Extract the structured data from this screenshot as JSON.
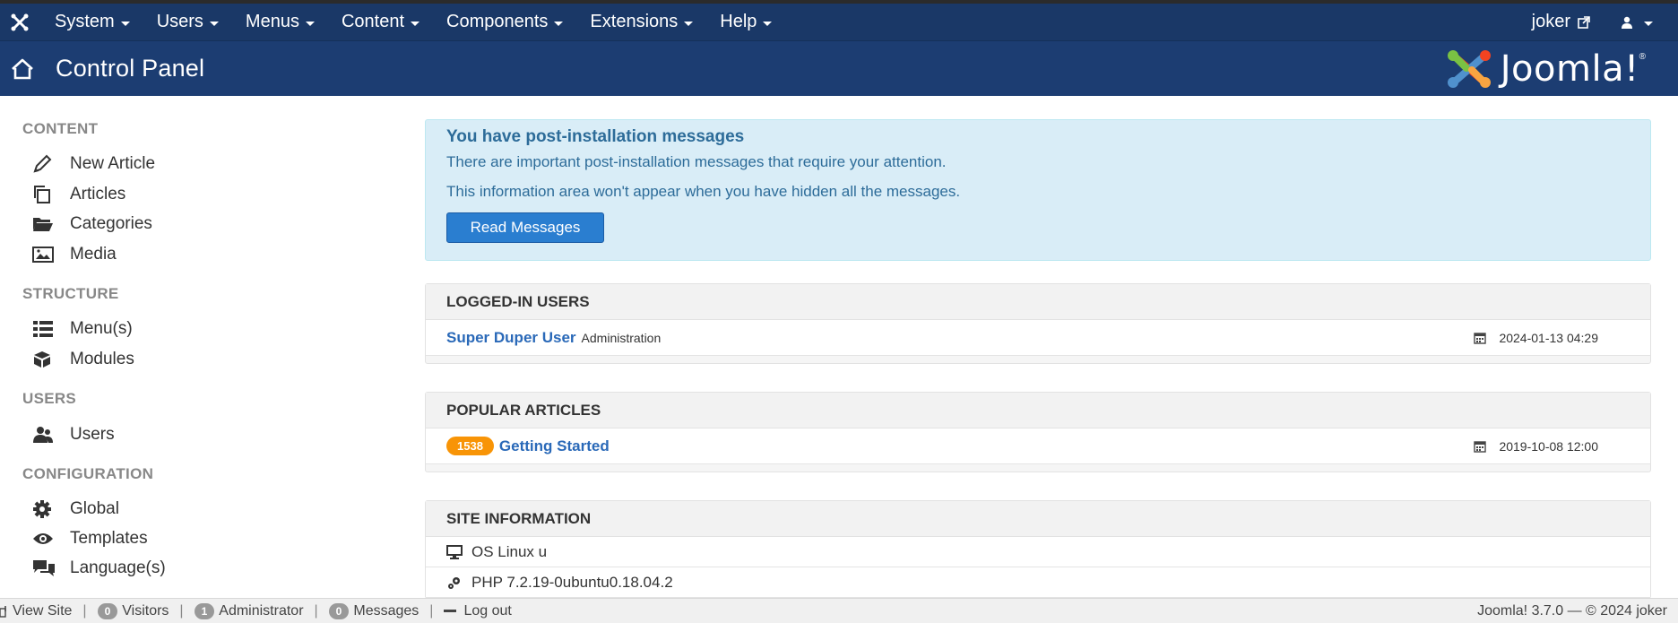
{
  "topbar": {
    "menu": [
      "System",
      "Users",
      "Menus",
      "Content",
      "Components",
      "Extensions",
      "Help"
    ],
    "user": "joker"
  },
  "header": {
    "title": "Control Panel",
    "logo_text": "Joomla!"
  },
  "sidebar": {
    "content_heading": "CONTENT",
    "new_article": "New Article",
    "articles": "Articles",
    "categories": "Categories",
    "media": "Media",
    "structure_heading": "STRUCTURE",
    "menus": "Menu(s)",
    "modules": "Modules",
    "users_heading": "USERS",
    "users": "Users",
    "config_heading": "CONFIGURATION",
    "global": "Global",
    "templates": "Templates",
    "languages": "Language(s)"
  },
  "alert": {
    "heading": "You have post-installation messages",
    "line1": "There are important post-installation messages that require your attention.",
    "line2": "This information area won't appear when you have hidden all the messages.",
    "button": "Read Messages"
  },
  "logged_in": {
    "heading": "LOGGED-IN USERS",
    "user_name": "Super Duper User",
    "user_area": "Administration",
    "date": "2024-01-13 04:29"
  },
  "popular": {
    "heading": "POPULAR ARTICLES",
    "hits": "1538",
    "title": "Getting Started",
    "date": "2019-10-08 12:00"
  },
  "site_info": {
    "heading": "SITE INFORMATION",
    "os": "OS Linux u",
    "php": "PHP 7.2.19-0ubuntu0.18.04.2"
  },
  "status": {
    "view_site": "View Site",
    "visitors_count": "0",
    "visitors": "Visitors",
    "admin_count": "1",
    "admin": "Administrator",
    "messages_count": "0",
    "messages": "Messages",
    "logout": "Log out",
    "version": "Joomla! 3.7.0 — © 2024 joker"
  }
}
